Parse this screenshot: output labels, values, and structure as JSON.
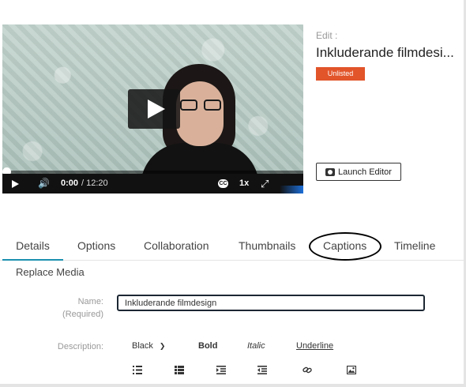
{
  "player": {
    "current_time": "0:00",
    "total_time": "/ 12:20",
    "speed": "1x",
    "cc_label": "CC",
    "progress_fraction": 0.0
  },
  "media": {
    "edit_label": "Edit :",
    "title": "Inkluderande filmdesi...",
    "status_badge": "Unlisted",
    "launch_editor_label": "Launch Editor"
  },
  "tabs": [
    {
      "label": "Details",
      "active": true
    },
    {
      "label": "Options",
      "active": false
    },
    {
      "label": "Collaboration",
      "active": false
    },
    {
      "label": "Thumbnails",
      "active": false
    },
    {
      "label": "Captions",
      "active": false
    },
    {
      "label": "Timeline",
      "active": false
    }
  ],
  "details": {
    "replace_media": "Replace Media",
    "name_label": "Name:",
    "name_required": "(Required)",
    "name_value": "Inkluderande filmdesign",
    "description_label": "Description:"
  },
  "toolbar": {
    "color_select": "Black",
    "bold": "Bold",
    "italic": "Italic",
    "underline": "Underline"
  },
  "colors": {
    "badge": "#e2542a",
    "active_tab": "#1b8fb0"
  }
}
